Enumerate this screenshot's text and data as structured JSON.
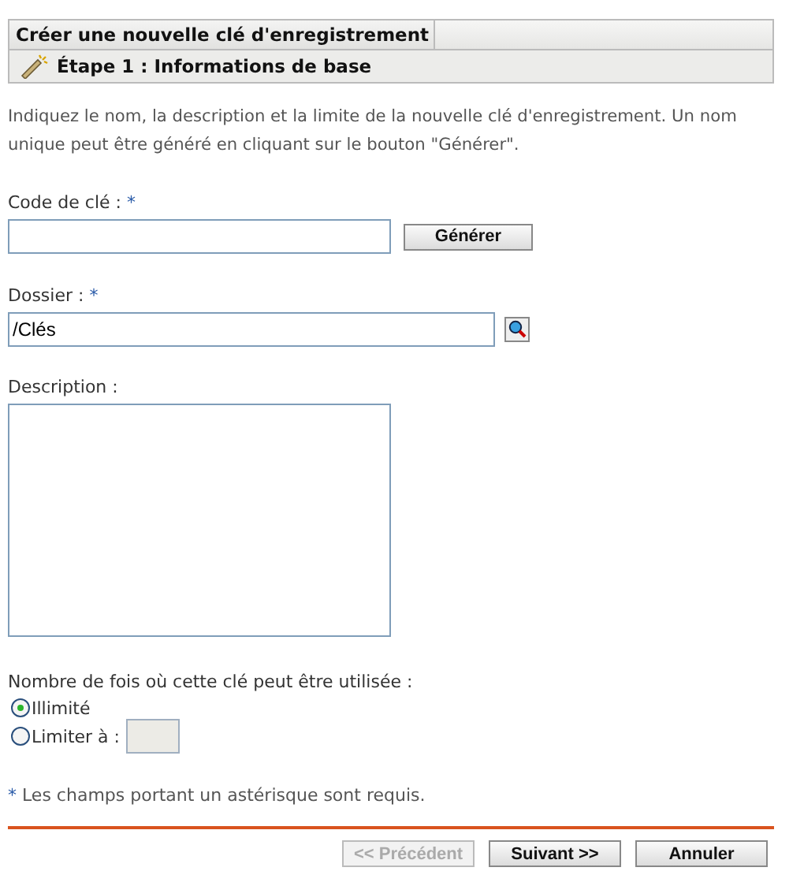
{
  "header": {
    "title": "Créer une nouvelle clé d'enregistrement",
    "step": "Étape 1 : Informations de base"
  },
  "intro": "Indiquez le nom, la description et la limite de la nouvelle clé d'enregistrement. Un nom unique peut être généré en cliquant sur le bouton \"Générer\".",
  "key_code": {
    "label": "Code de clé :",
    "required_mark": "*",
    "button": "Générer"
  },
  "folder": {
    "label": "Dossier :",
    "required_mark": "*",
    "value": "/Clés"
  },
  "description": {
    "label": "Description :"
  },
  "usage": {
    "label": "Nombre de fois où cette clé peut être utilisée :",
    "options": [
      {
        "kind": "plain",
        "label": "Illimité",
        "selected": true
      },
      {
        "kind": "limit",
        "label": "Limiter à :",
        "selected": false,
        "disabled": true
      }
    ]
  },
  "required_note": {
    "mark": "*",
    "text": "Les champs portant un astérisque sont requis."
  },
  "buttons": [
    {
      "label": "<< Précédent",
      "disabled": true
    },
    {
      "label": "Suivant >>",
      "disabled": false
    },
    {
      "label": "Annuler",
      "disabled": false
    }
  ]
}
